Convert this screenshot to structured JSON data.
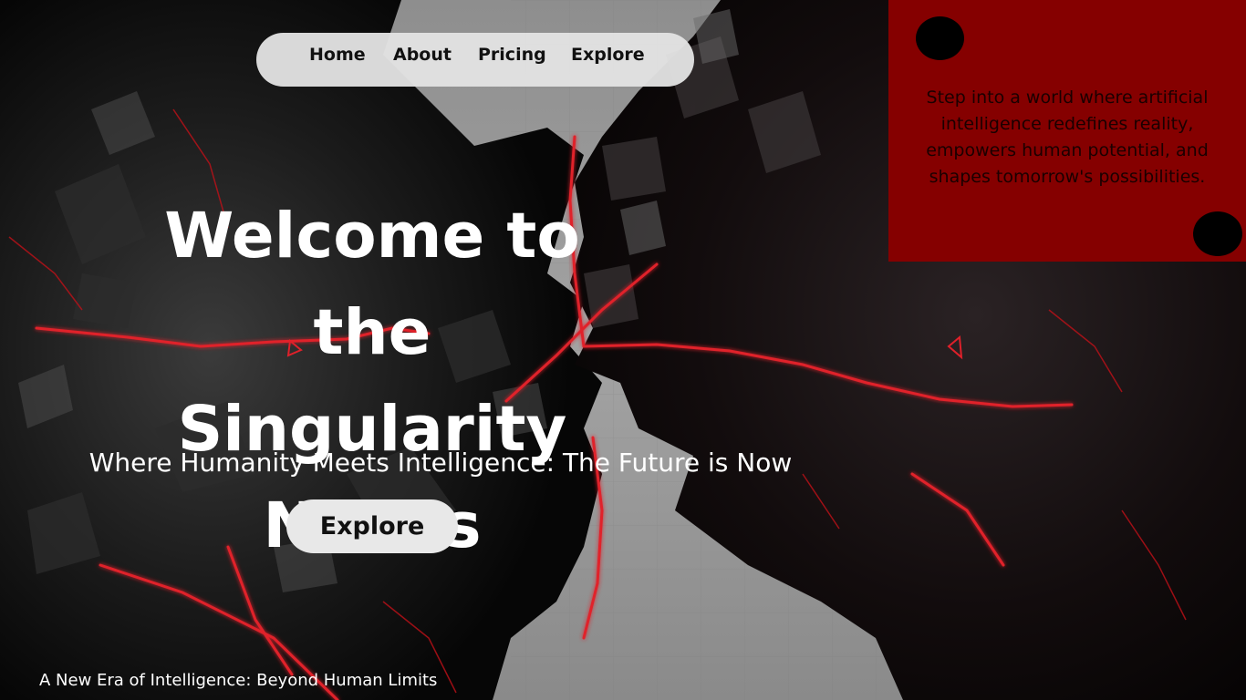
{
  "nav": {
    "items": [
      {
        "label": "Home"
      },
      {
        "label": "About"
      },
      {
        "label": "Pricing"
      },
      {
        "label": "Explore"
      }
    ]
  },
  "panel": {
    "text": "Step into a world where artificial intelligence redefines reality, empowers human potential, and shapes tomorrow's possibilities."
  },
  "hero": {
    "title_lines": [
      "Welcome to the",
      "Singularity",
      "Nexus"
    ],
    "subtitle": "Where Humanity Meets Intelligence: The Future is Now",
    "cta_label": "Explore"
  },
  "footer": {
    "tagline": "A New Era of Intelligence: Beyond Human Limits"
  },
  "colors": {
    "panel_red": "#850000",
    "accent_glow": "#e0202a",
    "nav_bg": "#e2e2e2",
    "text_white": "#ffffff"
  },
  "background": {
    "description_icon": "ai-faces-artwork"
  }
}
